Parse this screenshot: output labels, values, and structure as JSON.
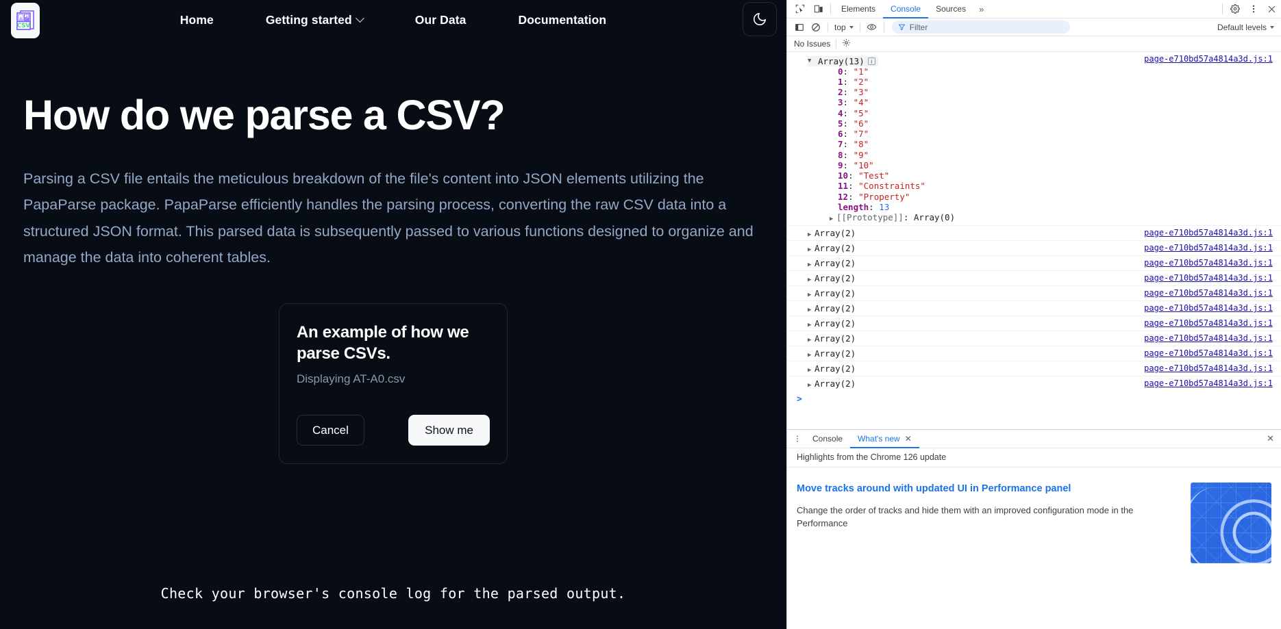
{
  "page": {
    "logo": {
      "icon": "csv-file-icon",
      "label": "CSV"
    },
    "nav": {
      "items": [
        {
          "label": "Home",
          "has_caret": false
        },
        {
          "label": "Getting started",
          "has_caret": true
        },
        {
          "label": "Our Data",
          "has_caret": false
        },
        {
          "label": "Documentation",
          "has_caret": false
        }
      ],
      "theme_toggle_icon": "moon-icon"
    },
    "hero": {
      "title": "How do we parse a CSV?",
      "paragraph": "Parsing a CSV file entails the meticulous breakdown of the file's content into JSON elements utilizing the PapaParse package. PapaParse efficiently handles the parsing process, converting the raw CSV data into a structured JSON format. This parsed data is subsequently passed to various functions designed to organize and manage the data into coherent tables."
    },
    "card": {
      "title": "An example of how we parse CSVs.",
      "subtitle": "Displaying AT-A0.csv",
      "cancel_label": "Cancel",
      "confirm_label": "Show me"
    },
    "note": "Check your browser's console log for the parsed output."
  },
  "devtools": {
    "tabbar": {
      "inspect_icon": "inspect-element-icon",
      "device_icon": "device-toolbar-icon",
      "tabs": [
        {
          "label": "Elements",
          "active": false
        },
        {
          "label": "Console",
          "active": true
        },
        {
          "label": "Sources",
          "active": false
        }
      ],
      "more_label": "»",
      "settings_icon": "gear-icon",
      "kebab_icon": "more-vertical-icon",
      "close_icon": "close-icon"
    },
    "toolbar": {
      "sidebar_icon": "console-sidebar-icon",
      "clear_icon": "clear-console-icon",
      "context_label": "top",
      "eye_icon": "live-expression-icon",
      "filter_icon": "filter-icon",
      "filter_placeholder": "Filter",
      "levels_label": "Default levels"
    },
    "issues": {
      "label": "No Issues",
      "settings_icon": "console-settings-gear-icon"
    },
    "console": {
      "source": "page-e710bd57a4814a3d.js:1",
      "expanded_entry": {
        "header": "Array(13)",
        "badge": "i",
        "properties": [
          {
            "key": "0",
            "value": "\"1\""
          },
          {
            "key": "1",
            "value": "\"2\""
          },
          {
            "key": "2",
            "value": "\"3\""
          },
          {
            "key": "3",
            "value": "\"4\""
          },
          {
            "key": "4",
            "value": "\"5\""
          },
          {
            "key": "5",
            "value": "\"6\""
          },
          {
            "key": "6",
            "value": "\"7\""
          },
          {
            "key": "7",
            "value": "\"8\""
          },
          {
            "key": "8",
            "value": "\"9\""
          },
          {
            "key": "9",
            "value": "\"10\""
          },
          {
            "key": "10",
            "value": "\"Test\""
          },
          {
            "key": "11",
            "value": "\"Constraints\""
          },
          {
            "key": "12",
            "value": "\"Property\""
          }
        ],
        "length_key": "length",
        "length_value": "13",
        "prototype_key": "[[Prototype]]",
        "prototype_value": "Array(0)"
      },
      "collapsed_entries": [
        {
          "label": "Array(2)",
          "source": "page-e710bd57a4814a3d.js:1"
        },
        {
          "label": "Array(2)",
          "source": "page-e710bd57a4814a3d.js:1"
        },
        {
          "label": "Array(2)",
          "source": "page-e710bd57a4814a3d.js:1"
        },
        {
          "label": "Array(2)",
          "source": "page-e710bd57a4814a3d.js:1"
        },
        {
          "label": "Array(2)",
          "source": "page-e710bd57a4814a3d.js:1"
        },
        {
          "label": "Array(2)",
          "source": "page-e710bd57a4814a3d.js:1"
        },
        {
          "label": "Array(2)",
          "source": "page-e710bd57a4814a3d.js:1"
        },
        {
          "label": "Array(2)",
          "source": "page-e710bd57a4814a3d.js:1"
        },
        {
          "label": "Array(2)",
          "source": "page-e710bd57a4814a3d.js:1"
        },
        {
          "label": "Array(2)",
          "source": "page-e710bd57a4814a3d.js:1"
        },
        {
          "label": "Array(2)",
          "source": "page-e710bd57a4814a3d.js:1"
        }
      ],
      "prompt_caret": ">"
    },
    "drawer": {
      "tabs": [
        {
          "label": "Console",
          "active": false,
          "closable": false
        },
        {
          "label": "What's new",
          "active": true,
          "closable": true
        }
      ],
      "close_label": "✕",
      "subtitle": "Highlights from the Chrome 126 update",
      "article": {
        "title": "Move tracks around with updated UI in Performance panel",
        "description": "Change the order of tracks and hide them with an improved configuration mode in the Performance",
        "thumbnail": "performance-panel-illustration"
      }
    }
  },
  "colors": {
    "page_bg": "#080d15",
    "nav_text": "#ffffff",
    "paragraph": "#93a8c6",
    "accent_blue": "#1a73e8",
    "string_red": "#c5221f",
    "key_purple": "#881280",
    "link_blue": "#1a0dab",
    "logo_purple": "#7c5cff",
    "logo_green": "#3ddc84"
  }
}
